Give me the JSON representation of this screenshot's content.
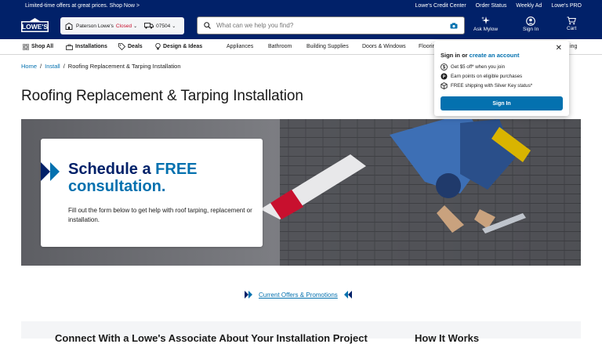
{
  "promo_bar": {
    "left_text": "Limited-time offers at great prices. Shop Now >",
    "links": [
      "Lowe's Credit Center",
      "Order Status",
      "Weekly Ad",
      "Lowe's PRO"
    ]
  },
  "header": {
    "logo_text": "LOWE'S",
    "store": {
      "name": "Paterson Lowe's",
      "status": "Closed",
      "zip": "07504"
    },
    "search": {
      "placeholder": "What can we help you find?"
    },
    "ask_label": "Ask Mylow",
    "signin_label": "Sign In",
    "cart_label": "Cart"
  },
  "nav": {
    "items": [
      "Shop All",
      "Installations",
      "Deals",
      "Design & Ideas",
      "Appliances",
      "Bathroom",
      "Building Supplies",
      "Doors & Windows",
      "Flooring"
    ],
    "truncated_right": "ing"
  },
  "breadcrumb": {
    "home": "Home",
    "install": "Install",
    "current": "Roofing Replacement & Tarping Installation"
  },
  "page_title": "Roofing Replacement & Tarping Installation",
  "hero": {
    "title_prefix": "Schedule a ",
    "title_free": "FREE",
    "title_line2": "consultation.",
    "body": "Fill out the form below to get help with roof tarping, replacement or installation."
  },
  "offers_link": "Current Offers & Promotions",
  "sections": {
    "connect": "Connect With a Lowe's Associate About Your Installation Project",
    "how": "How It Works"
  },
  "signin_popup": {
    "heading_prefix": "Sign in or ",
    "heading_link": "create an account",
    "benefits": [
      "Get $5 off* when you join",
      "Earn points on eligible purchases",
      "FREE shipping with Silver Key status*"
    ],
    "button": "Sign In"
  },
  "colors": {
    "brand_navy": "#012169",
    "link_blue": "#0471af",
    "closed_red": "#c8102e"
  }
}
